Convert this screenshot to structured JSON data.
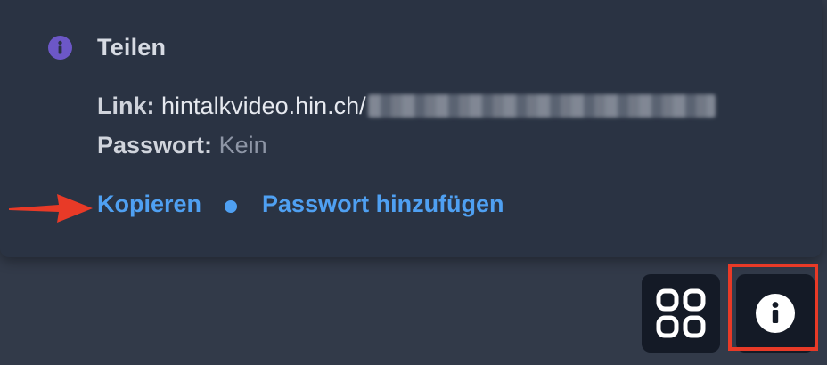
{
  "share_panel": {
    "title": "Teilen",
    "link_label": "Link:",
    "link_value": "hintalkvideo.hin.ch/",
    "password_label": "Passwort:",
    "password_value": "Kein",
    "copy_action": "Kopieren",
    "add_password_action": "Passwort hinzufügen"
  },
  "icons": {
    "title_icon": "info-icon",
    "grid_button_icon": "grid-icon",
    "info_button_icon": "info-icon",
    "annotation": "red-arrow-icon"
  },
  "colors": {
    "link_accent": "#4fa0f2",
    "info_badge": "#6c57c7",
    "annotation_red": "#e83a27"
  }
}
